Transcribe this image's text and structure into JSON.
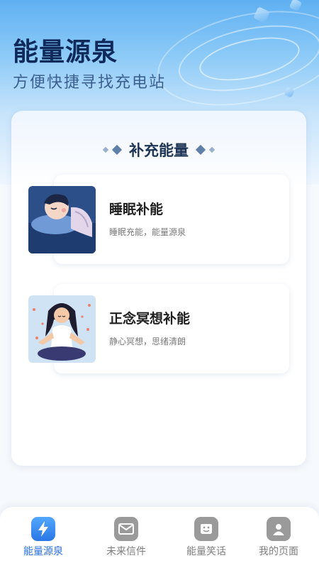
{
  "header": {
    "title": "能量源泉",
    "subtitle": "方便快捷寻找充电站"
  },
  "section": {
    "title": "补充能量"
  },
  "cards": [
    {
      "title": "睡眠补能",
      "subtitle": "睡眠充能，能量源泉"
    },
    {
      "title": "正念冥想补能",
      "subtitle": "静心冥想，思绪清朗"
    }
  ],
  "tabbar": {
    "items": [
      {
        "label": "能量源泉",
        "icon": "lightning-icon",
        "active": true
      },
      {
        "label": "未来信件",
        "icon": "mail-icon",
        "active": false
      },
      {
        "label": "能量笑话",
        "icon": "smile-icon",
        "active": false
      },
      {
        "label": "我的页面",
        "icon": "user-icon",
        "active": false
      }
    ]
  },
  "colors": {
    "accent": "#2a77e6",
    "title": "#0f2a5a",
    "tab_inactive": "#9a9a9a"
  }
}
